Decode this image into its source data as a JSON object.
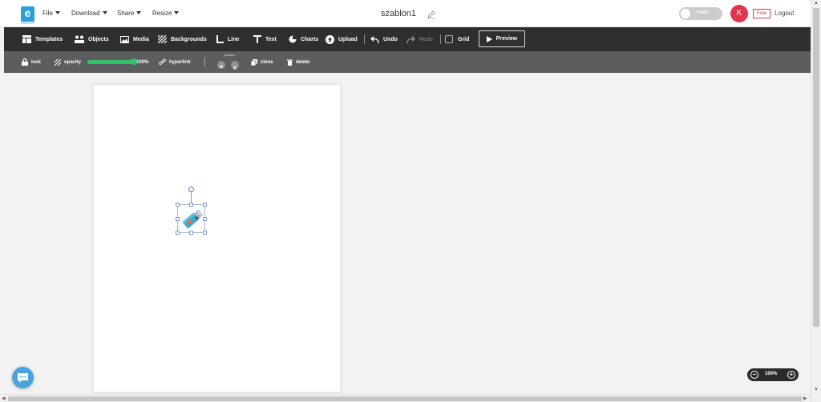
{
  "header": {
    "logo_letter": "e",
    "menus": [
      "File",
      "Download",
      "Share",
      "Resize"
    ],
    "doc_title": "szablon1",
    "public_toggle_label": "Public",
    "avatar_initial": "K",
    "plan_badge": "Free",
    "logout_label": "Logout"
  },
  "toolbar": {
    "templates": "Templates",
    "objects": "Objects",
    "media": "Media",
    "backgrounds": "Backgrounds",
    "line": "Line",
    "text": "Text",
    "charts": "Charts",
    "upload": "Upload",
    "undo": "Undo",
    "redo": "Redo",
    "grid": "Grid",
    "preview": "Preview"
  },
  "subbar": {
    "lock": "lock",
    "opacity": "opacity",
    "opacity_value": "100%",
    "opacity_level": 1.0,
    "hyperlink": "hyperlink",
    "position": "position",
    "clone": "clone",
    "delete": "delete"
  },
  "zoom": {
    "value": "100%"
  },
  "colors": {
    "accent": "#2b9fd9",
    "toolbar_bg": "#2f2f2f",
    "subbar_bg": "#5b5d5f",
    "slider": "#35c16b",
    "avatar": "#e3344d"
  }
}
